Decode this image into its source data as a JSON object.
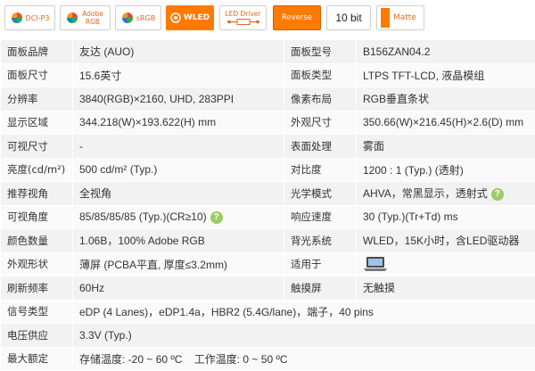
{
  "badges": {
    "dcip3": "DCI-P3",
    "adobe": "Adobe RGB",
    "srgb": "sRGB",
    "wled": "WLED",
    "led_driver": "LED Driver",
    "reverse": "Reverse",
    "tenbit": "10 bit",
    "matte": "Matte"
  },
  "colors": {
    "orange": "#ff7a00",
    "green_help": "#9ccc65",
    "row_odd": "#f2f2f2",
    "row_even": "#fafafa"
  },
  "spec": {
    "r1": {
      "l1": "面板品牌",
      "v1": "友达 (AUO)",
      "l2": "面板型号",
      "v2": "B156ZAN04.2"
    },
    "r2": {
      "l1": "面板尺寸",
      "v1": "15.6英寸",
      "l2": "面板类型",
      "v2": "LTPS TFT-LCD, 液晶模组"
    },
    "r3": {
      "l1": "分辨率",
      "v1": "3840(RGB)×2160, UHD, 283PPI",
      "l2": "像素布局",
      "v2": "RGB垂直条状"
    },
    "r4": {
      "l1": "显示区域",
      "v1": "344.218(W)×193.622(H) mm",
      "l2": "外观尺寸",
      "v2": "350.66(W)×216.45(H)×2.6(D) mm"
    },
    "r5": {
      "l1": "可视尺寸",
      "v1": "-",
      "l2": "表面处理",
      "v2": "雾面"
    },
    "r6": {
      "l1": "亮度(cd/m²)",
      "v1": "500 cd/m² (Typ.)",
      "l2": "对比度",
      "v2": "1200 : 1 (Typ.) (透射)"
    },
    "r7": {
      "l1": "推荐视角",
      "v1": "全视角",
      "l2": "光学模式",
      "v2": "AHVA，常黑显示，透射式"
    },
    "r8": {
      "l1": "可视角度",
      "v1": "85/85/85/85 (Typ.)(CR≥10)",
      "l2": "响应速度",
      "v2": "30 (Typ.)(Tr+Td) ms"
    },
    "r9": {
      "l1": "颜色数量",
      "v1": "1.06B，100% Adobe RGB",
      "l2": "背光系统",
      "v2": "WLED，15K小时，含LED驱动器"
    },
    "r10": {
      "l1": "外观形状",
      "v1": "薄屏 (PCBA平直, 厚度≤3.2mm)",
      "l2": "适用于",
      "v2": ""
    },
    "r11": {
      "l1": "刷新频率",
      "v1": "60Hz",
      "l2": "触摸屏",
      "v2": "无触摸"
    },
    "r12": {
      "l1": "信号类型",
      "v1": "eDP (4 Lanes)，eDP1.4a，HBR2 (5.4G/lane)，端子，40 pins"
    },
    "r13": {
      "l1": "电压供应",
      "v1": "3.3V (Typ.)"
    },
    "r14": {
      "l1": "最大额定",
      "v1": "存储温度: -20 ~ 60 ºC    工作温度: 0 ~ 50 ºC"
    }
  }
}
